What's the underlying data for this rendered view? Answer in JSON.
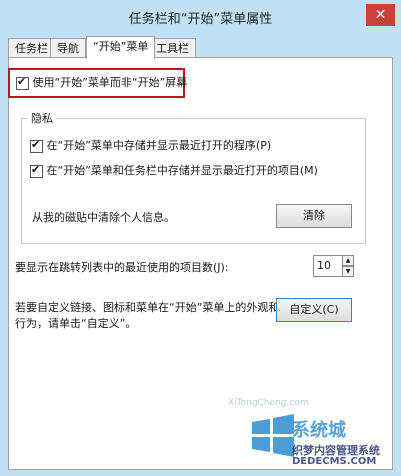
{
  "window": {
    "title": "任务栏和“开始”菜单属性",
    "close_glyph": "✕"
  },
  "tabs": [
    {
      "label": "任务栏"
    },
    {
      "label": "导航"
    },
    {
      "label": "“开始”菜单"
    },
    {
      "label": "工具栏"
    }
  ],
  "start_menu_option": {
    "label": "使用“开始”菜单而非“开始”屏幕",
    "checked": true
  },
  "privacy": {
    "title": "隐私",
    "store_programs": {
      "label": "在“开始”菜单中存储并显示最近打开的程序(P)",
      "checked": true
    },
    "store_items": {
      "label": "在“开始”菜单和任务栏中存储并显示最近打开的项目(M)",
      "checked": true
    },
    "clear_text": "从我的磁贴中清除个人信息。",
    "clear_button": "清除"
  },
  "jump_list": {
    "label": "要显示在跳转列表中的最近使用的项目数(J):",
    "value": "10"
  },
  "customize": {
    "text_line1": "若要自定义链接、图标和菜单在“开始”菜单上的外观和",
    "text_line2": "行为，请单击“自定义”。",
    "button": "自定义(C)"
  },
  "watermark": {
    "logo_text": "系统城",
    "line1": "织梦内容管理系统",
    "line2": "DEDECMS.COM",
    "faint": "XiTongCheng.com"
  },
  "colors": {
    "title_bar": "#bfe1f3",
    "close": "#c9413a",
    "highlight_border": "#c0171e"
  }
}
